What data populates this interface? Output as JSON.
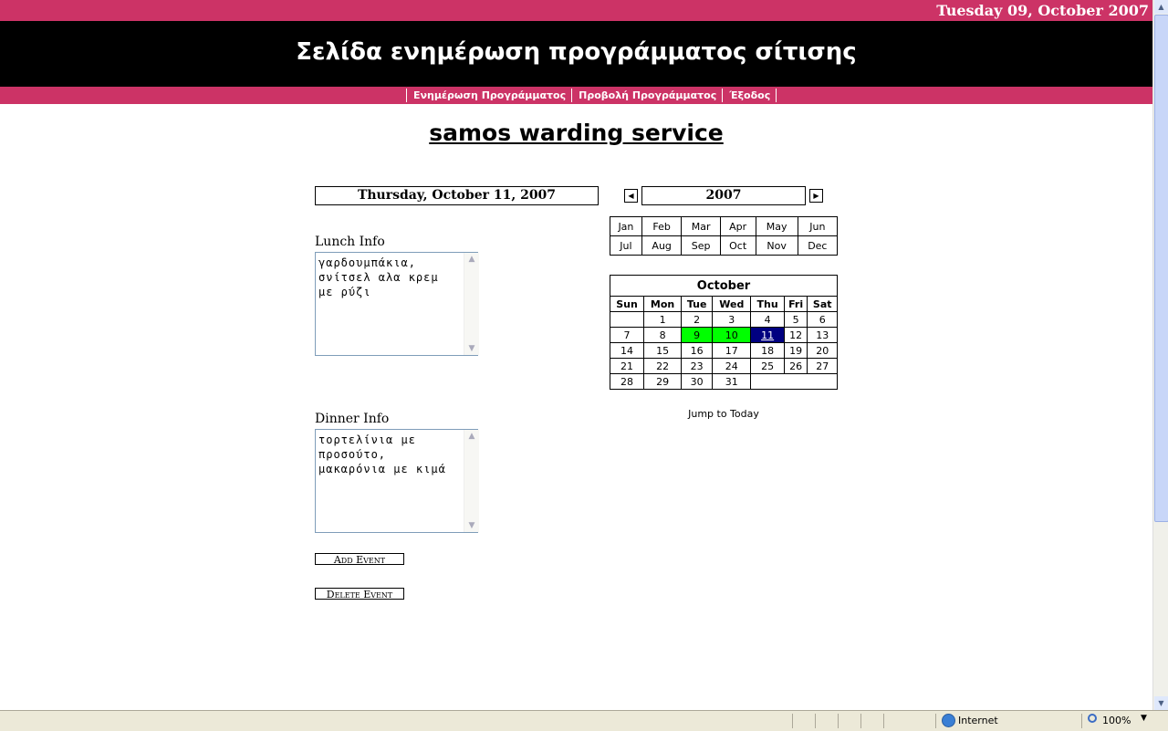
{
  "header": {
    "current_date": "Tuesday 09, October 2007",
    "page_title": "Σελίδα ενημέρωση προγράμματος σίτισης"
  },
  "nav": {
    "items": [
      "Ενημέρωση Προγράμματος",
      "Προβολή Προγράμματος",
      "Έξοδος"
    ]
  },
  "site_title": "samos warding service",
  "selected_date": "Thursday, October 11, 2007",
  "lunch": {
    "label": "Lunch Info",
    "value": "γαρδουμπάκια,\nσνίτσελ αλα κρεμ\nμε ρύζι"
  },
  "dinner": {
    "label": "Dinner Info",
    "value": "τορτελίνια με\nπροσούτο,\nμακαρόνια με κιμά"
  },
  "buttons": {
    "add": "Add Event",
    "delete": "Delete Event"
  },
  "calendar": {
    "year": "2007",
    "months": [
      [
        "Jan",
        "Feb",
        "Mar",
        "Apr",
        "May",
        "Jun"
      ],
      [
        "Jul",
        "Aug",
        "Sep",
        "Oct",
        "Nov",
        "Dec"
      ]
    ],
    "month_name": "October",
    "weekdays": [
      "Sun",
      "Mon",
      "Tue",
      "Wed",
      "Thu",
      "Fri",
      "Sat"
    ],
    "weeks": [
      [
        "",
        "1",
        "2",
        "3",
        "4",
        "5",
        "6"
      ],
      [
        "7",
        "8",
        "9",
        "10",
        "11",
        "12",
        "13"
      ],
      [
        "14",
        "15",
        "16",
        "17",
        "18",
        "19",
        "20"
      ],
      [
        "21",
        "22",
        "23",
        "24",
        "25",
        "26",
        "27"
      ],
      [
        "28",
        "29",
        "30",
        "31",
        "",
        "",
        ""
      ]
    ],
    "highlighted_days": [
      "9",
      "10"
    ],
    "selected_day": "11",
    "highlight_color": "#00ff00",
    "selected_color": "#000080",
    "jump_label": "Jump to Today"
  },
  "colors": {
    "accent": "#cc3366",
    "header_bg": "#000000"
  },
  "statusbar": {
    "zone": "Internet",
    "zoom": "100%"
  }
}
